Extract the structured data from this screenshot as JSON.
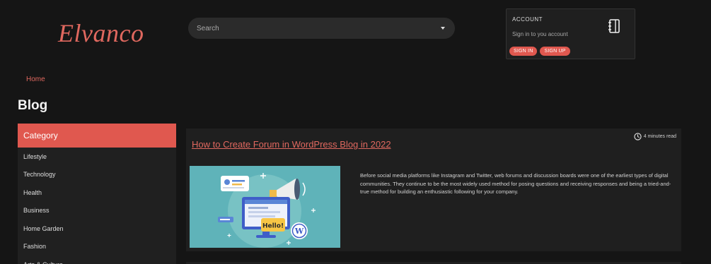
{
  "header": {
    "logo": "Elvanco",
    "search_placeholder": "Search",
    "account": {
      "title": "ACCOUNT",
      "subtitle": "Sign in to you account",
      "sign_in": "SIGN IN",
      "sign_up": "SIGN UP",
      "icon": "notebook-icon"
    }
  },
  "breadcrumb": {
    "home": "Home"
  },
  "page": {
    "title": "Blog"
  },
  "sidebar": {
    "header": "Category",
    "items": [
      {
        "label": "Lifestyle"
      },
      {
        "label": "Technology"
      },
      {
        "label": "Health"
      },
      {
        "label": "Business"
      },
      {
        "label": "Home Garden"
      },
      {
        "label": "Fashion"
      },
      {
        "label": "Arts & Culture"
      }
    ]
  },
  "post": {
    "title": "How to Create Forum in WordPress Blog in 2022",
    "read_time": "4 minutes read",
    "excerpt": "Before social media platforms like Instagram and Twitter, web forums and discussion boards were one of the earliest types of digital communities. They continue to be the most widely used method for posing questions and receiving responses and being a tried-and-true method for building an enthusiastic following for your company.",
    "thumbnail_text": "Hello!"
  },
  "colors": {
    "background": "#151515",
    "accent": "#e0584f",
    "panel": "#1f1f1f"
  }
}
